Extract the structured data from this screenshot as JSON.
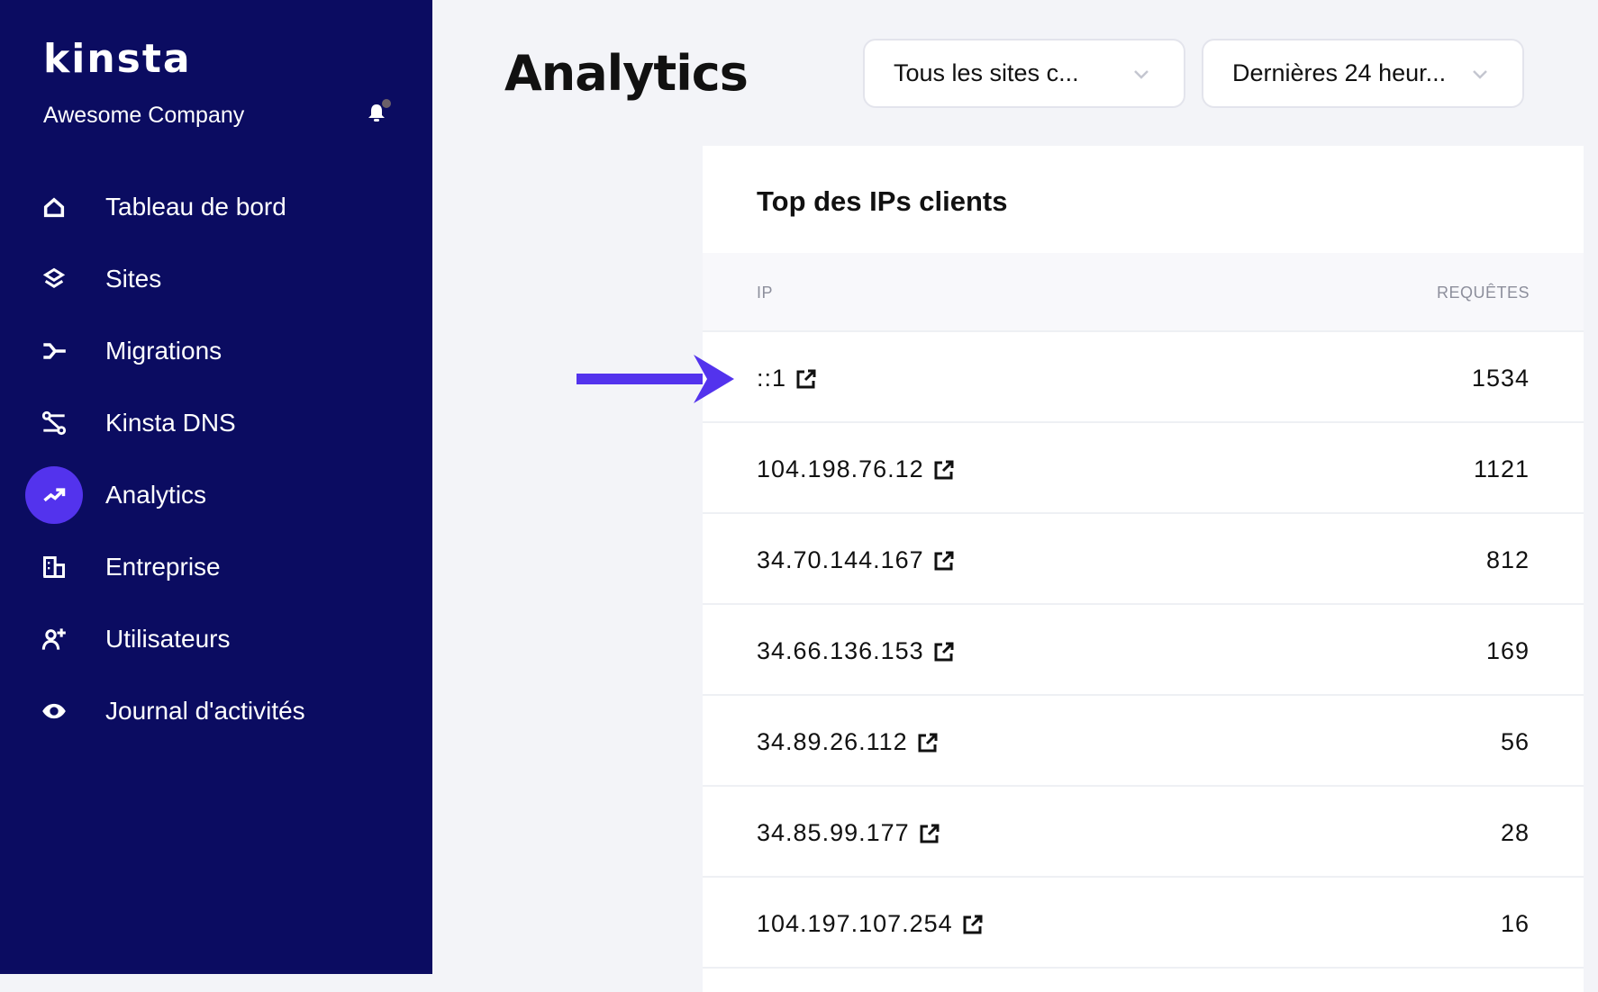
{
  "sidebar": {
    "logo": "KINSTA",
    "company": "Awesome Company",
    "notification_icon": "bell-icon",
    "items": [
      {
        "label": "Tableau de bord",
        "icon": "home-icon",
        "active": false
      },
      {
        "label": "Sites",
        "icon": "layers-icon",
        "active": false
      },
      {
        "label": "Migrations",
        "icon": "migrations-icon",
        "active": false
      },
      {
        "label": "Kinsta DNS",
        "icon": "dns-icon",
        "active": false
      },
      {
        "label": "Analytics",
        "icon": "trending-up-icon",
        "active": true
      },
      {
        "label": "Entreprise",
        "icon": "building-icon",
        "active": false
      },
      {
        "label": "Utilisateurs",
        "icon": "user-add-icon",
        "active": false
      },
      {
        "label": "Journal d'activités",
        "icon": "eye-icon",
        "active": false
      }
    ]
  },
  "header": {
    "title": "Analytics",
    "site_filter": "Tous les sites c...",
    "time_filter": "Dernières 24 heur..."
  },
  "card": {
    "title": "Top des IPs clients",
    "columns": [
      "IP",
      "REQUÊTES"
    ],
    "rows": [
      {
        "ip": "::1",
        "requests": "1534"
      },
      {
        "ip": "104.198.76.12",
        "requests": "1121"
      },
      {
        "ip": "34.70.144.167",
        "requests": "812"
      },
      {
        "ip": "34.66.136.153",
        "requests": "169"
      },
      {
        "ip": "34.89.26.112",
        "requests": "56"
      },
      {
        "ip": "34.85.99.177",
        "requests": "28"
      },
      {
        "ip": "104.197.107.254",
        "requests": "16"
      }
    ]
  },
  "colors": {
    "sidebar": "#0b0c61",
    "accent": "#5333ed",
    "background": "#f3f4f8"
  }
}
